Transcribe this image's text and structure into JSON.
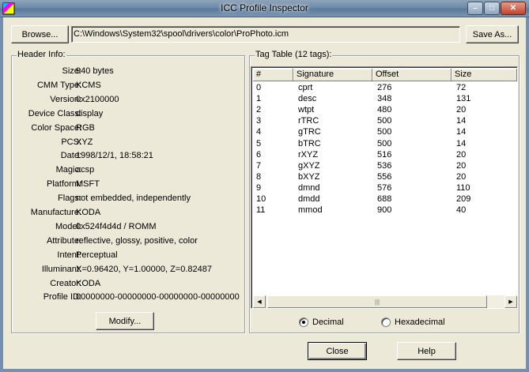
{
  "window": {
    "title": "ICC Profile Inspector",
    "minimize_glyph": "–",
    "maximize_glyph": "□",
    "close_glyph": "✕"
  },
  "toolbar": {
    "browse_label": "Browse...",
    "path_value": "C:\\Windows\\System32\\spool\\drivers\\color\\ProPhoto.icm",
    "save_as_label": "Save As..."
  },
  "header_info": {
    "group_label": "Header Info:",
    "fields": [
      {
        "key": "Size:",
        "value": "940 bytes"
      },
      {
        "key": "CMM Type:",
        "value": "KCMS"
      },
      {
        "key": "Version:",
        "value": "0x2100000"
      },
      {
        "key": "Device Class:",
        "value": "display"
      },
      {
        "key": "Color Space:",
        "value": "RGB"
      },
      {
        "key": "PCS:",
        "value": "XYZ"
      },
      {
        "key": "Date:",
        "value": "1998/12/1, 18:58:21"
      },
      {
        "key": "Magic:",
        "value": "acsp"
      },
      {
        "key": "Platform:",
        "value": "MSFT"
      },
      {
        "key": "Flags:",
        "value": "not embedded, independently"
      },
      {
        "key": "Manufacture:",
        "value": "KODA"
      },
      {
        "key": "Model:",
        "value": "0x524f4d4d / ROMM"
      },
      {
        "key": "Attribute:",
        "value": "reflective, glossy, positive, color"
      },
      {
        "key": "Intent:",
        "value": "Perceptual"
      },
      {
        "key": "Illuminant:",
        "value": "X=0.96420, Y=1.00000, Z=0.82487"
      },
      {
        "key": "Creator:",
        "value": "KODA"
      },
      {
        "key": "Profile ID:",
        "value": "00000000-00000000-00000000-00000000"
      }
    ],
    "modify_label": "Modify..."
  },
  "tag_table": {
    "group_label": "Tag Table (12 tags):",
    "columns": [
      "#",
      "Signature",
      "Offset",
      "Size"
    ],
    "rows": [
      [
        "0",
        "cprt",
        "276",
        "72"
      ],
      [
        "1",
        "desc",
        "348",
        "131"
      ],
      [
        "2",
        "wtpt",
        "480",
        "20"
      ],
      [
        "3",
        "rTRC",
        "500",
        "14"
      ],
      [
        "4",
        "gTRC",
        "500",
        "14"
      ],
      [
        "5",
        "bTRC",
        "500",
        "14"
      ],
      [
        "6",
        "rXYZ",
        "516",
        "20"
      ],
      [
        "7",
        "gXYZ",
        "536",
        "20"
      ],
      [
        "8",
        "bXYZ",
        "556",
        "20"
      ],
      [
        "9",
        "dmnd",
        "576",
        "110"
      ],
      [
        "10",
        "dmdd",
        "688",
        "209"
      ],
      [
        "11",
        "mmod",
        "900",
        "40"
      ]
    ],
    "radio_decimal": "Decimal",
    "radio_hex": "Hexadecimal",
    "selected_format": "Decimal"
  },
  "footer": {
    "close_label": "Close",
    "help_label": "Help"
  },
  "colors": {
    "titlebar": "#6d8aa8",
    "dialog_bg": "#ece9d8",
    "list_bg": "#ffffff"
  }
}
